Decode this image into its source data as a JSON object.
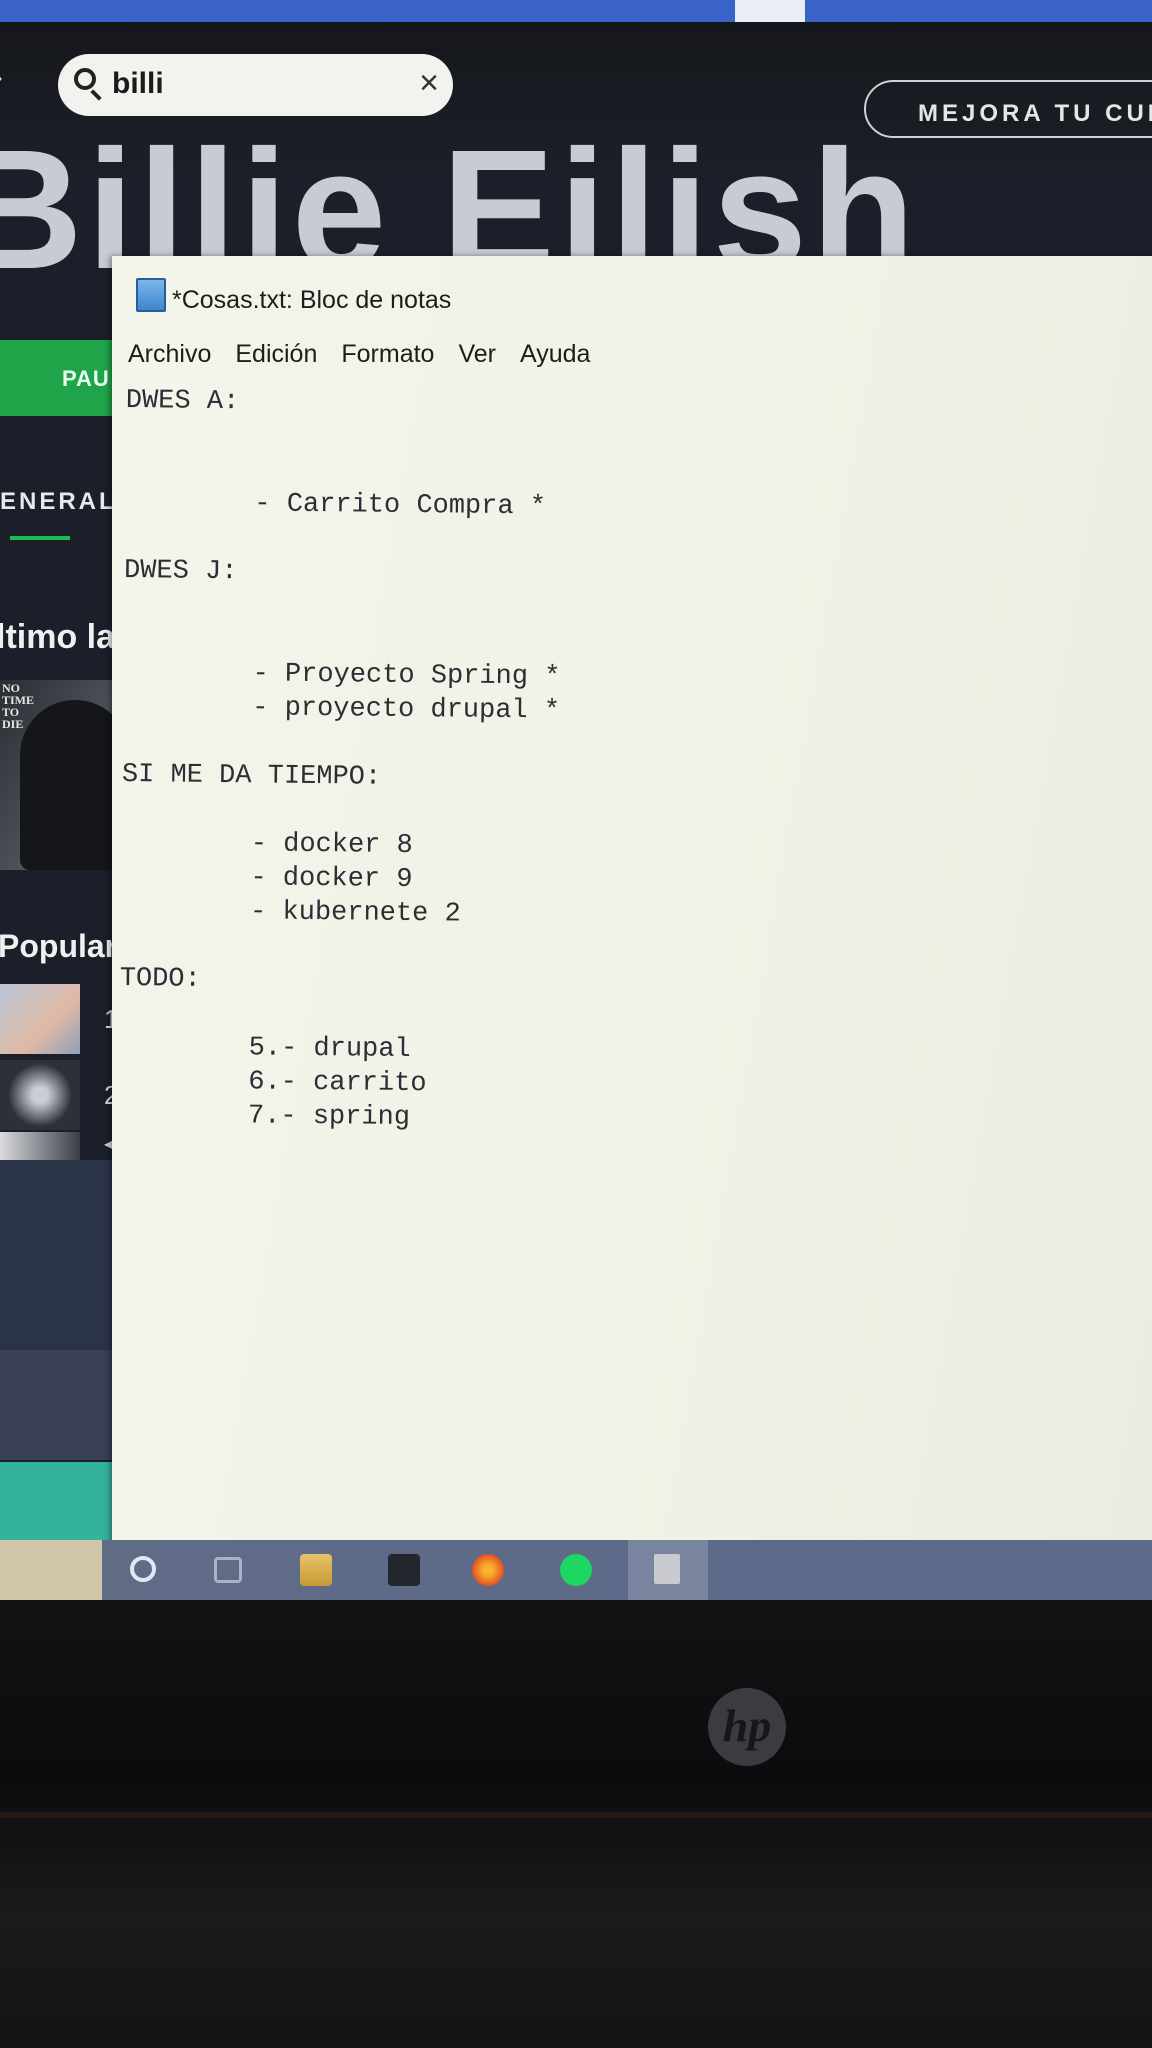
{
  "spotify": {
    "search": {
      "query": "billi"
    },
    "upgrade_label": "MEJORA TU CUE",
    "artist_banner": "Billie Eilish",
    "play_label": "PAU",
    "tab_general": "ENERAL",
    "latest_heading": "ltimo la",
    "album_cover_text": "NO TIME TO DIE",
    "popular_heading": "Populare",
    "tracks": [
      {
        "number": "1"
      },
      {
        "number": "2"
      },
      {
        "number": ""
      }
    ]
  },
  "notepad": {
    "title": "*Cosas.txt: Bloc de notas",
    "menu": [
      "Archivo",
      "Edición",
      "Formato",
      "Ver",
      "Ayuda"
    ],
    "content": "DWES A:\n\n\n        - Carrito Compra *\n\nDWES J:\n\n\n        - Proyecto Spring *\n        - proyecto drupal *\n\nSI ME DA TIEMPO:\n\n        - docker 8\n        - docker 9\n        - kubernete 2\n\nTODO:\n\n        5.- drupal\n        6.- carrito\n        7.- spring"
  },
  "taskbar": {
    "icons": [
      "cortana-icon",
      "task-view-icon",
      "file-explorer-icon",
      "folder-icon",
      "firefox-icon",
      "spotify-icon",
      "notepad-icon"
    ]
  },
  "bezel": {
    "logo": "hp"
  },
  "colors": {
    "spotify_green": "#1db954",
    "taskbar": "#5c6a89",
    "notepad_bg": "#f1f2e7"
  }
}
